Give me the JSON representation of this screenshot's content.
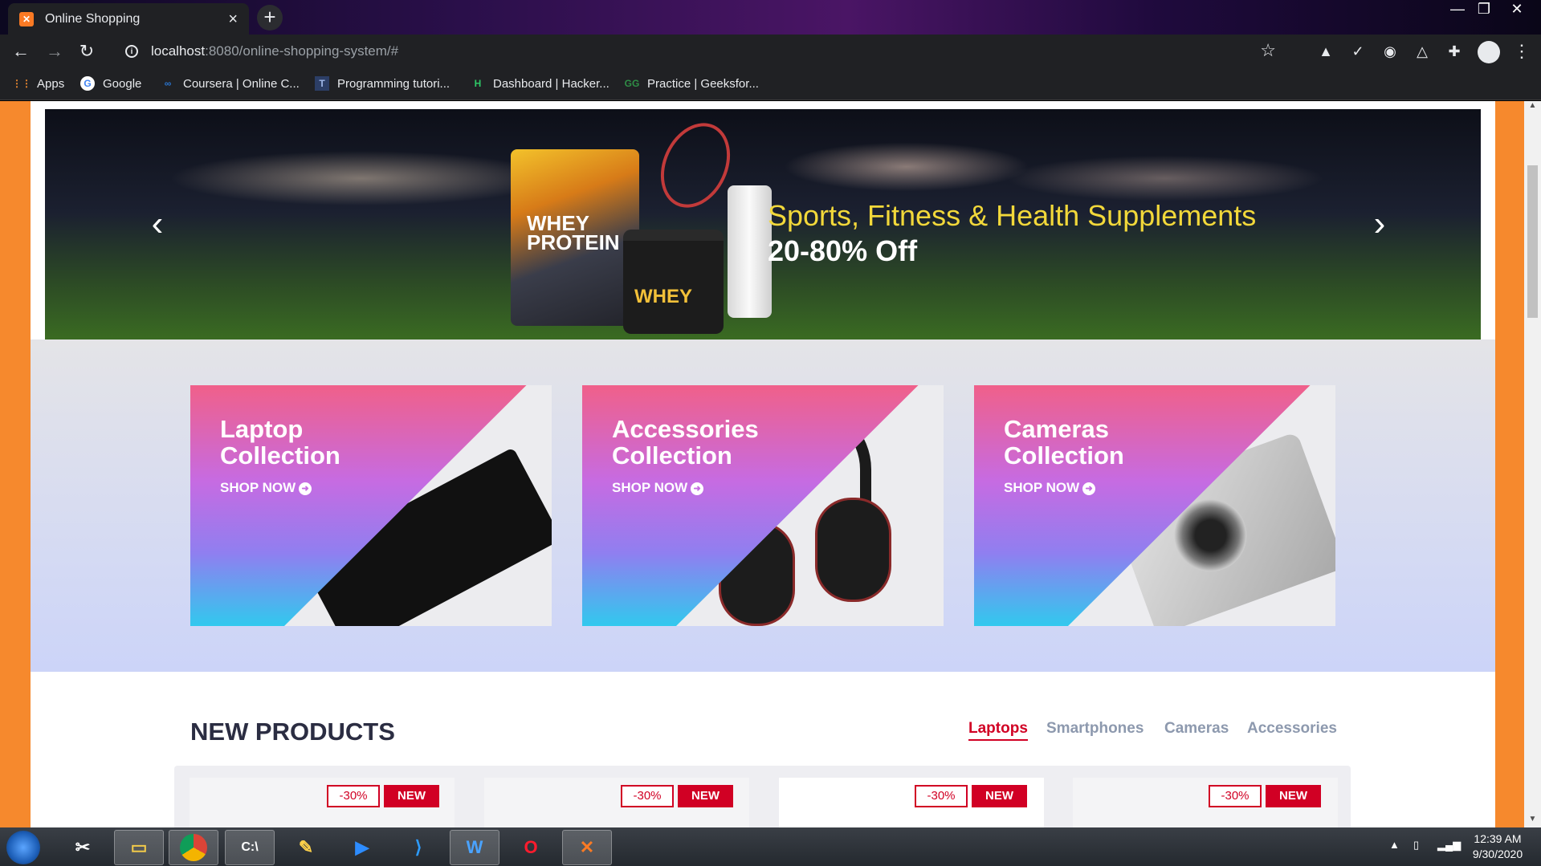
{
  "browser": {
    "tab": {
      "title": "Online Shopping",
      "favicon": "xampp-icon"
    },
    "url": {
      "host": "localhost",
      "path": ":8080/online-shopping-system/#"
    },
    "bookmarks": [
      {
        "label": "Apps",
        "icon": "apps-grid-icon"
      },
      {
        "label": "Google",
        "icon": "google-icon"
      },
      {
        "label": "Coursera | Online C...",
        "icon": "coursera-icon"
      },
      {
        "label": "Programming tutori...",
        "icon": "tutorial-icon"
      },
      {
        "label": "Dashboard | Hacker...",
        "icon": "hackerrank-icon"
      },
      {
        "label": "Practice | Geeksfor...",
        "icon": "geeksforgeeks-icon"
      }
    ]
  },
  "hero": {
    "line1": "Sports, Fitness & Health Supplements",
    "line2": "20-80% Off",
    "product_bag": "WHEY PROTEIN",
    "product_tub": "WHEY"
  },
  "collections": [
    {
      "title_line1": "Laptop",
      "title_line2": "Collection",
      "cta": "SHOP NOW"
    },
    {
      "title_line1": "Accessories",
      "title_line2": "Collection",
      "cta": "SHOP NOW"
    },
    {
      "title_line1": "Cameras",
      "title_line2": "Collection",
      "cta": "SHOP NOW"
    }
  ],
  "new_products": {
    "title": "NEW PRODUCTS",
    "tabs": [
      "Laptops",
      "Smartphones",
      "Cameras",
      "Accessories"
    ],
    "active_tab": "Laptops",
    "cards": [
      {
        "sale": "-30%",
        "new": "NEW"
      },
      {
        "sale": "-30%",
        "new": "NEW"
      },
      {
        "sale": "-30%",
        "new": "NEW"
      },
      {
        "sale": "-30%",
        "new": "NEW"
      }
    ]
  },
  "taskbar": {
    "clock_time": "12:39 AM",
    "clock_date": "9/30/2020"
  },
  "colors": {
    "accent_red": "#d10024",
    "page_orange": "#f6892d",
    "hero_yellow": "#f2d83a"
  }
}
